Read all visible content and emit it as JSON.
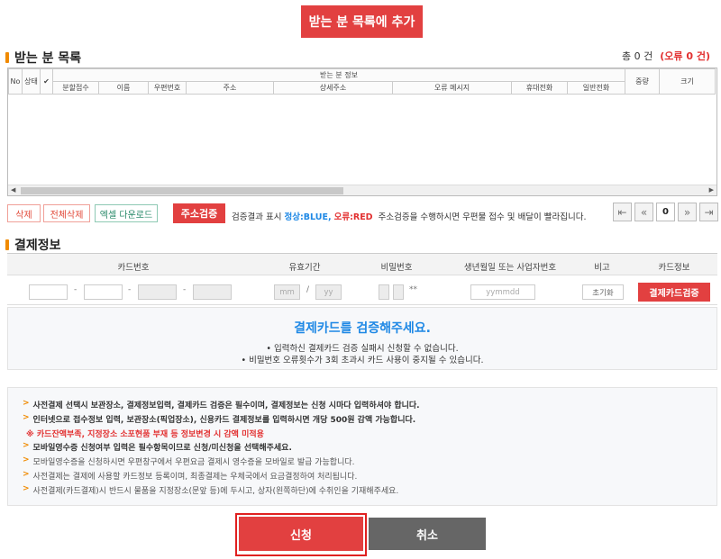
{
  "top": {
    "add_label": "받는 분 목록에 추가"
  },
  "recipients": {
    "title": "받는 분 목록",
    "total": "총 0 건",
    "errors": "(오류 0 건)",
    "columns": {
      "no": "No",
      "status": "상태",
      "check": "✔",
      "group": "받는 분 정보",
      "split": "분할접수",
      "name": "이름",
      "zip": "우편번호",
      "address": "주소",
      "detail": "상세주소",
      "error_msg": "오류 메시지",
      "mobile": "휴대전화",
      "phone": "일반전화",
      "weight": "중량",
      "size": "크기"
    },
    "delete_label": "삭제",
    "delete_all_label": "전체삭제",
    "excel_label": "엑셀 다운로드",
    "verify_label": "주소검증",
    "legend_prefix": "검증결과 표시",
    "legend_ok": "정상:BLUE,",
    "legend_err": "오류:RED",
    "legend_note": "주소검증을 수행하시면 우편물 접수 및 배달이 빨라집니다.",
    "page_current": "0"
  },
  "payment": {
    "title": "결제정보",
    "headers": {
      "card_no": "카드번호",
      "expiry": "유효기간",
      "password": "비밀번호",
      "birth": "생년월일 또는 사업자번호",
      "note": "비고",
      "card_info": "카드정보"
    },
    "dash": "-",
    "mm_placeholder": "mm",
    "slash": "/",
    "yy_placeholder": "yy",
    "pw_mask": "**",
    "birth_placeholder": "yymmdd",
    "reset_label": "초기화",
    "card_verify_label": "결제카드검증"
  },
  "notice": {
    "title": "결제카드를 검증해주세요.",
    "line1": "• 입력하신 결제카드 검증 실패시 신청할 수 없습니다.",
    "line2": "• 비밀번호 오류횟수가 3회 초과시 카드 사용이 중지될 수 있습니다."
  },
  "info": {
    "l1": "사전결제 선택시 보관장소, 결제정보입력, 결제카드 검증은 필수이며, 결제정보는 신청 시마다 입력하셔야 합니다.",
    "l2": "인터넷으로 접수정보 입력, 보관장소(픽업장소), 신용카드 결제정보를 입력하시면 개당 500원 감액 가능합니다.",
    "l3": "※ 카드잔액부족, 지정장소 소포현품 부재 등 정보변경 시 감액 미적용",
    "l4": "모바일영수증 신청여부 입력은 필수항목이므로 신청/미신청을 선택해주세요.",
    "l5": "모바일영수증을 신청하시면 우편창구에서 우편요금 결제시 영수증을 모바일로 발급 가능합니다.",
    "l6": "사전결제는 결제에 사용할 카드정보 등록이며, 최종결제는 우체국에서 요금결정하여 처리됩니다.",
    "l7": "사전결제(카드결제)시 반드시 물품을 지정장소(문앞 등)에 두시고, 상자(왼쪽하단)에 수취인을 기재해주세요.",
    "arrow": ">"
  },
  "actions": {
    "apply_label": "신청",
    "cancel_label": "취소"
  },
  "icons": {
    "first": "first-page-icon",
    "prev": "prev-page-icon",
    "next": "next-page-icon",
    "last": "last-page-icon"
  },
  "colors": {
    "primary_red": "#e24040",
    "blue": "#1e88e5",
    "orange": "#f08a00",
    "gray_btn": "#666666"
  }
}
